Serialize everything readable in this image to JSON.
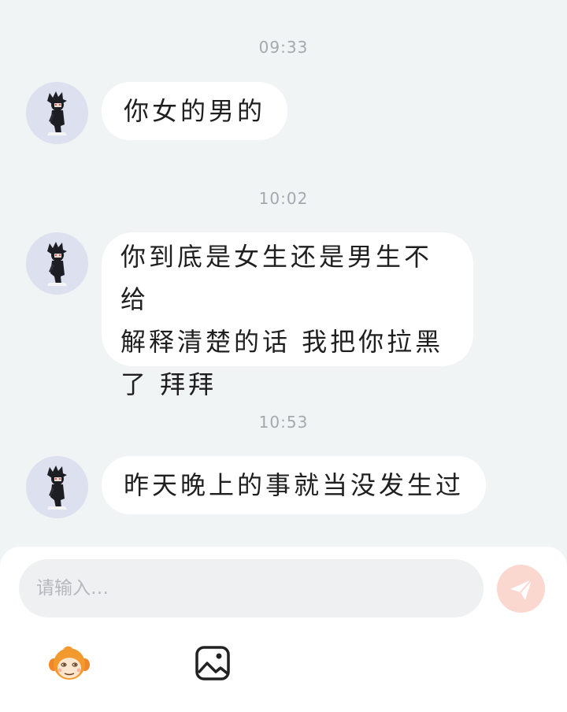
{
  "messages": [
    {
      "time": "09:33",
      "text": "你女的男的"
    },
    {
      "time": "10:02",
      "lines": [
        "你到底是女生还是男生不给",
        "解释清楚的话 我把你拉黑",
        "了 拜拜"
      ]
    },
    {
      "time": "10:53",
      "text": "昨天晚上的事就当没发生过"
    }
  ],
  "composer": {
    "placeholder": "请输入…",
    "send_icon": "paper-plane-icon",
    "sticker_icon": "monkey-sticker-icon",
    "image_icon": "image-icon"
  },
  "colors": {
    "background": "#f1f4f5",
    "bubble": "#ffffff",
    "send_button": "#fbd8cf",
    "avatar_bg": "#dde0ee"
  }
}
